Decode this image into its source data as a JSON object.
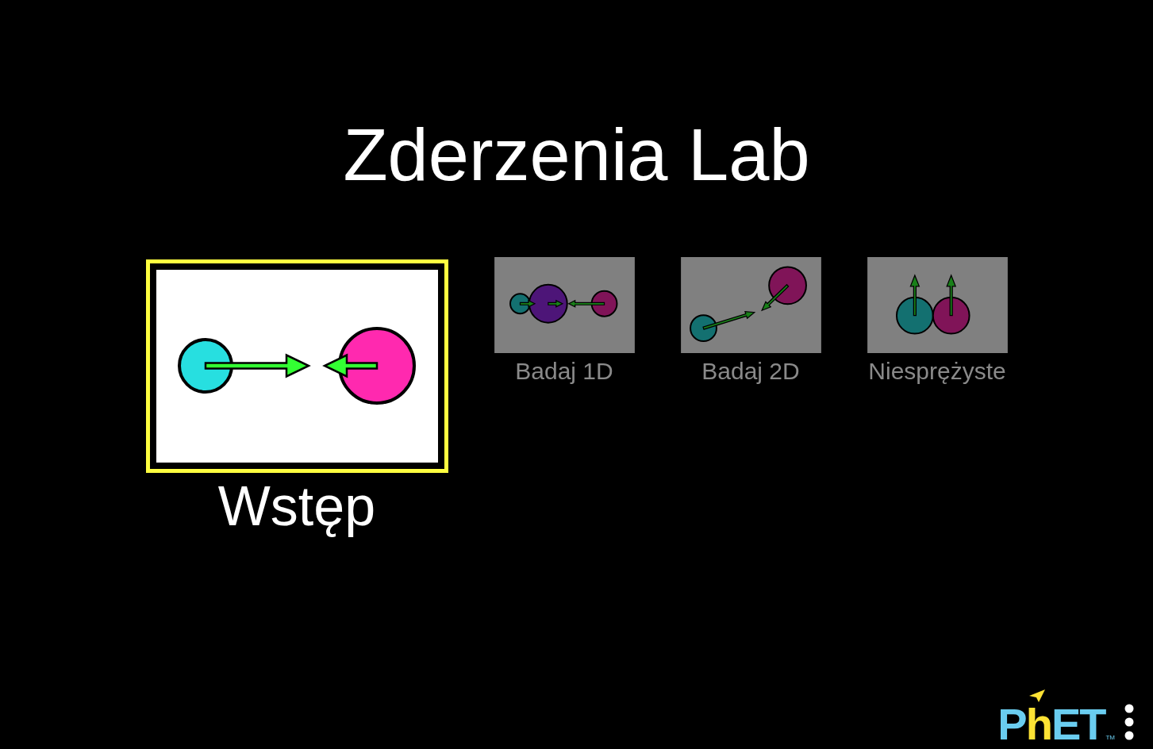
{
  "title": "Zderzenia Lab",
  "screens": [
    {
      "label": "Wstęp",
      "kind": "intro",
      "selected": true
    },
    {
      "label": "Badaj 1D",
      "kind": "explore1d",
      "selected": false
    },
    {
      "label": "Badaj 2D",
      "kind": "explore2d",
      "selected": false
    },
    {
      "label": "Niesprężyste",
      "kind": "inelastic",
      "selected": false
    }
  ],
  "logo": {
    "segments": [
      {
        "text": "P",
        "color": "#6acdf0"
      },
      {
        "text": "h",
        "color": "#fde234"
      },
      {
        "text": "ET",
        "color": "#6acdf0"
      }
    ],
    "trademark": "TM"
  }
}
